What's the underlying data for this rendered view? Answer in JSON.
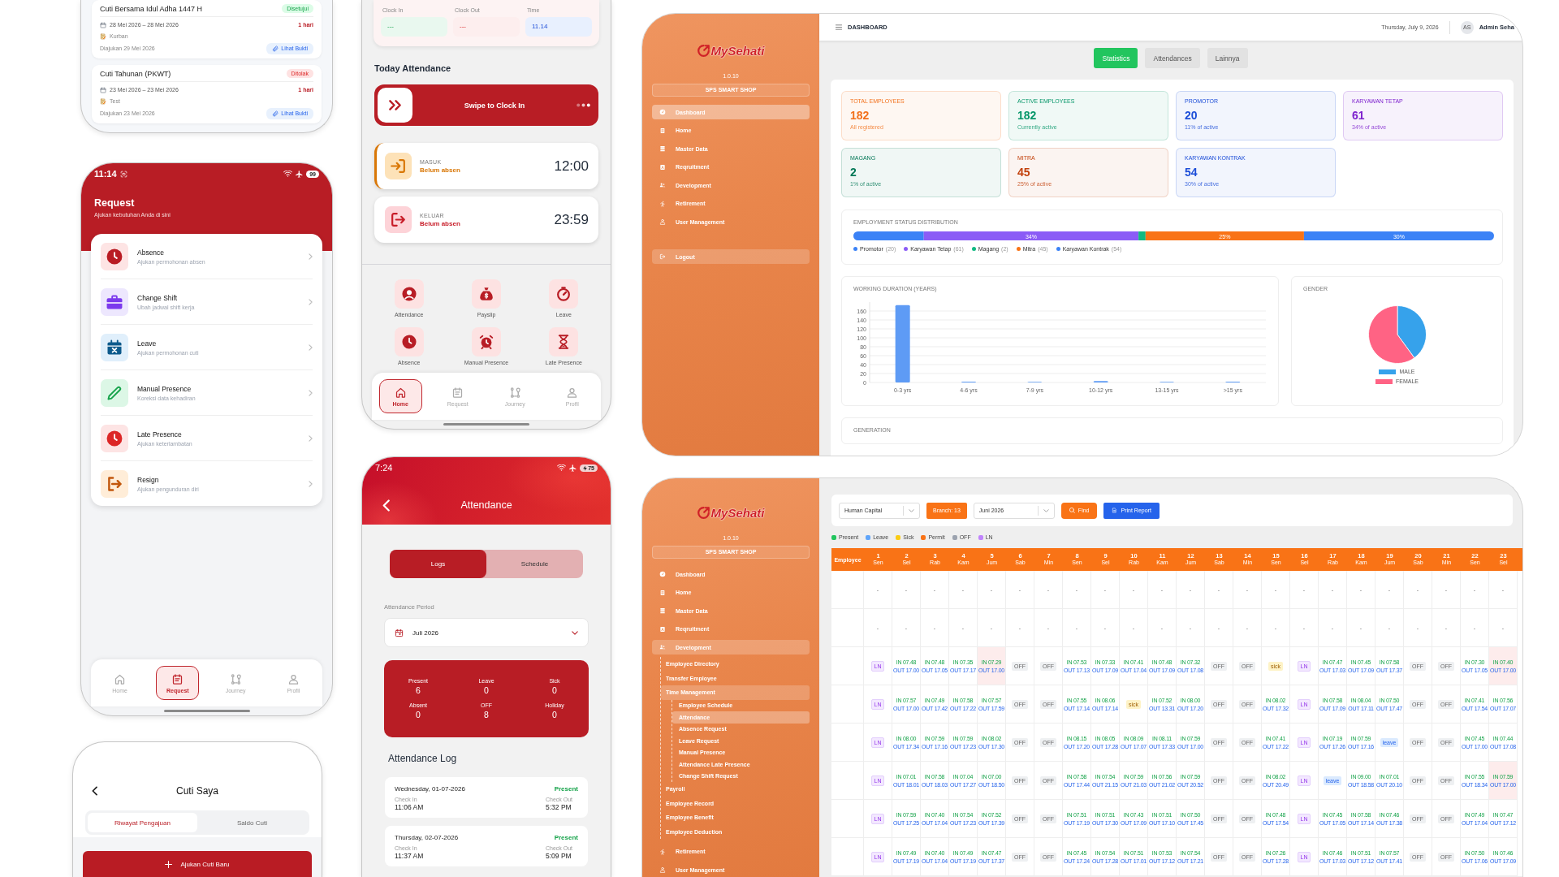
{
  "phone_leave_history": {
    "cards": [
      {
        "title": "Cuti Bersama Idul Adha 1447 H",
        "status": {
          "text": "Disetujui",
          "kind": "approved"
        },
        "dates": "28 Mei 2026 – 28 Mei 2026",
        "duration": "1 hari",
        "note": "Kurban",
        "submitted": "Diajukan 29 Mei 2026",
        "proof_button": "Lihat Bukti"
      },
      {
        "title": "Cuti Tahunan (PKWT)",
        "status": {
          "text": "Ditolak",
          "kind": "rejected"
        },
        "dates": "23 Mei 2026 – 23 Mei 2026",
        "duration": "1 hari",
        "note": "Test",
        "submitted": "Diajukan 23 Mei 2026",
        "proof_button": "Lihat Bukti"
      }
    ]
  },
  "phone_request": {
    "status_bar": {
      "time": "11:14",
      "battery": "99",
      "charging": false
    },
    "title": "Request",
    "subtitle": "Ajukan kebutuhan Anda di sini",
    "items": [
      {
        "title": "Absence",
        "subtitle": "Ajukan permohonan absen",
        "color": "#fde4e4"
      },
      {
        "title": "Change Shift",
        "subtitle": "Ubah jadwal shift kerja",
        "color": "#ede7fe"
      },
      {
        "title": "Leave",
        "subtitle": "Ajukan permohonan cuti",
        "color": "#e0effb"
      },
      {
        "title": "Manual Presence",
        "subtitle": "Koreksi data kehadiran",
        "color": "#dcf7e6"
      },
      {
        "title": "Late Presence",
        "subtitle": "Ajukan keterlambatan",
        "color": "#fde4e4"
      },
      {
        "title": "Resign",
        "subtitle": "Ajukan pengunduran diri",
        "color": "#ffedd8"
      }
    ],
    "nav": [
      {
        "label": "Home",
        "selected": false
      },
      {
        "label": "Request",
        "selected": true
      },
      {
        "label": "Journey",
        "selected": false
      },
      {
        "label": "Profil",
        "selected": false
      }
    ]
  },
  "phone_my_leave": {
    "title": "Cuti Saya",
    "tabs": [
      {
        "label": "Riwayat Pengajuan",
        "selected": true
      },
      {
        "label": "Saldo Cuti",
        "selected": false
      }
    ],
    "new_button": "Ajukan Cuti Baru"
  },
  "phone_home": {
    "summary": [
      {
        "label": "Clock In",
        "value": "---",
        "color": "#e9f8ef"
      },
      {
        "label": "Clock Out",
        "value": "---",
        "color": "#fdeeee"
      },
      {
        "label": "Time",
        "value": "11.14",
        "color": "#e8f0fe"
      }
    ],
    "section_title": "Today Attendance",
    "swipe": {
      "label": "Swipe to Clock In",
      "level": 0
    },
    "shifts": [
      {
        "label": "MASUK",
        "status": "Belum absen",
        "time": "12:00",
        "color": "#fde2b8",
        "active": true
      },
      {
        "label": "KELUAR",
        "status": "Belum absen",
        "time": "23:59",
        "color": "#fdd3d8",
        "active": false
      }
    ],
    "menu": [
      "Attendance",
      "Payslip",
      "Leave",
      "Absence",
      "Manual Presence",
      "Late Presence"
    ],
    "nav": [
      {
        "label": "Home",
        "selected": true
      },
      {
        "label": "Request",
        "selected": false
      },
      {
        "label": "Journey",
        "selected": false
      },
      {
        "label": "Profil",
        "selected": false
      }
    ]
  },
  "phone_attendance": {
    "status_bar": {
      "time": "7:24",
      "battery": "75",
      "charging": true
    },
    "title": "Attendance",
    "tabs": [
      {
        "label": "Logs",
        "selected": true
      },
      {
        "label": "Schedule",
        "selected": false
      }
    ],
    "period_label": "Attendance Period",
    "period": "Juli 2026",
    "summary": [
      {
        "label": "Present",
        "value": "6"
      },
      {
        "label": "Leave",
        "value": "0"
      },
      {
        "label": "Sick",
        "value": "0"
      },
      {
        "label": "Absent",
        "value": "0"
      },
      {
        "label": "OFF",
        "value": "8"
      },
      {
        "label": "Holiday",
        "value": "0"
      }
    ],
    "log_title": "Attendance Log",
    "logs": [
      {
        "date": "Wednesday, 01-07-2026",
        "status": "Present",
        "check_in_label": "Check In",
        "check_in": "11:06 AM",
        "check_out_label": "Check Out",
        "check_out": "5:32 PM"
      },
      {
        "date": "Thursday, 02-07-2026",
        "status": "Present",
        "check_in_label": "Check In",
        "check_in": "11:37 AM",
        "check_out_label": "Check Out",
        "check_out": "5:09 PM"
      }
    ]
  },
  "dashboard": {
    "sidebar": {
      "app_name": "MySehati",
      "version": "1.0.10",
      "company": "SPS SMART SHOP",
      "items": [
        {
          "label": "Dashboard",
          "selected": true
        },
        {
          "label": "Home",
          "selected": false
        },
        {
          "label": "Master Data",
          "selected": false
        },
        {
          "label": "Reqruitment",
          "selected": false
        },
        {
          "label": "Development",
          "selected": false
        },
        {
          "label": "Retirement",
          "selected": false
        },
        {
          "label": "User Management",
          "selected": false
        }
      ],
      "logout": "Logout"
    },
    "header": {
      "title": "DASHBOARD",
      "date": "Thursday, July 9, 2026",
      "avatar": "AS",
      "user": "Admin Seha"
    },
    "tabs": [
      {
        "label": "Statistics",
        "selected": true
      },
      {
        "label": "Attendances",
        "selected": false
      },
      {
        "label": "Lainnya",
        "selected": false
      }
    ],
    "stats": [
      {
        "title": "TOTAL EMPLOYEES",
        "value": "182",
        "caption": "All registered",
        "color": "#f2711c"
      },
      {
        "title": "ACTIVE EMPLOYEES",
        "value": "182",
        "caption": "Currently active",
        "color": "#059669"
      },
      {
        "title": "PROMOTOR",
        "value": "20",
        "caption": "11% of active",
        "color": "#1d4ed8"
      },
      {
        "title": "KARYAWAN TETAP",
        "value": "61",
        "caption": "34% of active",
        "color": "#7e22ce"
      },
      {
        "title": "MAGANG",
        "value": "2",
        "caption": "1% of active",
        "color": "#047857"
      },
      {
        "title": "MITRA",
        "value": "45",
        "caption": "25% of active",
        "color": "#c2410c"
      },
      {
        "title": "KARYAWAN KONTRAK",
        "value": "54",
        "caption": "30% of active",
        "color": "#1d4ed8"
      }
    ],
    "distribution": {
      "title": "EMPLOYMENT STATUS DISTRIBUTION",
      "groups": [
        {
          "name": "Promotor",
          "count": "(20)",
          "color": "#3b82f6"
        },
        {
          "name": "Karyawan Tetap",
          "count": "(61)",
          "color": "#8b5cf6",
          "share_label": "34%"
        },
        {
          "name": "Magang",
          "count": "(2)",
          "color": "#10b981"
        },
        {
          "name": "Mitra",
          "count": "(45)",
          "color": "#f97316",
          "share_label": "25%"
        },
        {
          "name": "Karyawan Kontrak",
          "count": "(54)",
          "color": "#3b82f6",
          "share_label": "30%"
        }
      ]
    },
    "duration_chart": {
      "chart_data": {
        "type": "bar",
        "title": "WORKING DURATION (YEARS)",
        "categories": [
          "0-3 yrs",
          "4-6 yrs",
          "7-9 yrs",
          "10-12 yrs",
          "13-15 yrs",
          ">15 yrs"
        ],
        "values": [
          173,
          2,
          1,
          3,
          1,
          2
        ],
        "ylim": [
          0,
          180
        ],
        "yticks": [
          0,
          20,
          40,
          60,
          80,
          100,
          120,
          140,
          160
        ],
        "grid": true
      }
    },
    "gender_chart": {
      "chart_data": {
        "type": "pie",
        "title": "GENDER",
        "categories": [
          "MALE",
          "FEMALE"
        ],
        "values": [
          40,
          60
        ],
        "colors": [
          "#36a2eb",
          "#ff6384"
        ],
        "legend": "bottom"
      }
    },
    "generation": {
      "title": "GENERATION"
    }
  },
  "attendance_report": {
    "sidebar": {
      "app_name": "MySehati",
      "version": "1.0.10",
      "company": "SPS SMART SHOP",
      "items": [
        {
          "label": "Dashboard",
          "selected": false
        },
        {
          "label": "Home",
          "selected": false
        },
        {
          "label": "Master Data",
          "selected": false
        },
        {
          "label": "Reqruitment",
          "selected": false
        },
        {
          "label": "Development",
          "selected": false,
          "expanded": true,
          "children": [
            {
              "label": "Employee Directory",
              "selected": false
            },
            {
              "label": "Transfer Employee",
              "selected": false
            },
            {
              "label": "Time Management",
              "selected": false,
              "expanded": true,
              "children": [
                {
                  "label": "Employee Schedule",
                  "selected": false
                },
                {
                  "label": "Attendance",
                  "selected": true
                },
                {
                  "label": "Absence Request",
                  "selected": false
                },
                {
                  "label": "Leave Request",
                  "selected": false
                },
                {
                  "label": "Manual Presence",
                  "selected": false
                },
                {
                  "label": "Attendance Late Presence",
                  "selected": false
                },
                {
                  "label": "Change Shift Request",
                  "selected": false
                }
              ]
            },
            {
              "label": "Payroll",
              "selected": false
            },
            {
              "label": "Employee Record",
              "selected": false
            },
            {
              "label": "Employee Benefit",
              "selected": false
            },
            {
              "label": "Employee Deduction",
              "selected": false
            }
          ]
        },
        {
          "label": "Retirement",
          "selected": false
        },
        {
          "label": "User Management",
          "selected": false
        }
      ]
    },
    "filters": {
      "department": "Human Capital",
      "branch": "Branch: 13",
      "period": "Juni 2026",
      "find": "Find",
      "print": "Print Report"
    },
    "legend": [
      {
        "label": "Present",
        "color": "#22c55e"
      },
      {
        "label": "Leave",
        "color": "#60a5fa"
      },
      {
        "label": "Sick",
        "color": "#facc15"
      },
      {
        "label": "Permit",
        "color": "#f97316"
      },
      {
        "label": "OFF",
        "color": "#9ca3af"
      },
      {
        "label": "LN",
        "color": "#c084fc"
      }
    ],
    "table": {
      "employee_header": "Employee",
      "days": [
        {
          "date": "1",
          "day": "Sen"
        },
        {
          "date": "2",
          "day": "Sel"
        },
        {
          "date": "3",
          "day": "Rab"
        },
        {
          "date": "4",
          "day": "Kam"
        },
        {
          "date": "5",
          "day": "Jum"
        },
        {
          "date": "6",
          "day": "Sab"
        },
        {
          "date": "7",
          "day": "Min"
        },
        {
          "date": "8",
          "day": "Sen"
        },
        {
          "date": "9",
          "day": "Sel"
        },
        {
          "date": "10",
          "day": "Rab"
        },
        {
          "date": "11",
          "day": "Kam"
        },
        {
          "date": "12",
          "day": "Jum"
        },
        {
          "date": "13",
          "day": "Sab"
        },
        {
          "date": "14",
          "day": "Min"
        },
        {
          "date": "15",
          "day": "Sen"
        },
        {
          "date": "16",
          "day": "Sel"
        },
        {
          "date": "17",
          "day": "Rab"
        },
        {
          "date": "18",
          "day": "Kam"
        },
        {
          "date": "19",
          "day": "Jum"
        },
        {
          "date": "20",
          "day": "Sab"
        },
        {
          "date": "21",
          "day": "Min"
        },
        {
          "date": "22",
          "day": "Sen"
        },
        {
          "date": "23",
          "day": "Sel"
        }
      ],
      "rows": [
        [
          {
            "kind": "empty",
            "text": "-"
          },
          {
            "kind": "empty",
            "text": "-"
          },
          {
            "kind": "empty",
            "text": "-"
          },
          {
            "kind": "empty",
            "text": "-"
          },
          {
            "kind": "empty",
            "text": "-"
          },
          {
            "kind": "empty",
            "text": "-"
          },
          {
            "kind": "empty",
            "text": "-"
          },
          {
            "kind": "empty",
            "text": "-"
          },
          {
            "kind": "empty",
            "text": "-"
          },
          {
            "kind": "empty",
            "text": "-"
          },
          {
            "kind": "empty",
            "text": "-"
          },
          {
            "kind": "empty",
            "text": "-"
          },
          {
            "kind": "empty",
            "text": "-"
          },
          {
            "kind": "empty",
            "text": "-"
          },
          {
            "kind": "empty",
            "text": "-"
          },
          {
            "kind": "empty",
            "text": "-"
          },
          {
            "kind": "empty",
            "text": "-"
          },
          {
            "kind": "empty",
            "text": "-"
          },
          {
            "kind": "empty",
            "text": "-"
          },
          {
            "kind": "empty",
            "text": "-"
          },
          {
            "kind": "empty",
            "text": "-"
          },
          {
            "kind": "empty",
            "text": "-"
          },
          {
            "kind": "empty",
            "text": "-"
          }
        ],
        [
          {
            "kind": "empty",
            "text": "-"
          },
          {
            "kind": "empty",
            "text": "-"
          },
          {
            "kind": "empty",
            "text": "-"
          },
          {
            "kind": "empty",
            "text": "-"
          },
          {
            "kind": "empty",
            "text": "-"
          },
          {
            "kind": "empty",
            "text": "-"
          },
          {
            "kind": "empty",
            "text": "-"
          },
          {
            "kind": "empty",
            "text": "-"
          },
          {
            "kind": "empty",
            "text": "-"
          },
          {
            "kind": "empty",
            "text": "-"
          },
          {
            "kind": "empty",
            "text": "-"
          },
          {
            "kind": "empty",
            "text": "-"
          },
          {
            "kind": "empty",
            "text": "-"
          },
          {
            "kind": "empty",
            "text": "-"
          },
          {
            "kind": "empty",
            "text": "-"
          },
          {
            "kind": "empty",
            "text": "-"
          },
          {
            "kind": "empty",
            "text": "-"
          },
          {
            "kind": "empty",
            "text": "-"
          },
          {
            "kind": "empty",
            "text": "-"
          },
          {
            "kind": "empty",
            "text": "-"
          },
          {
            "kind": "empty",
            "text": "-"
          },
          {
            "kind": "empty",
            "text": "-"
          },
          {
            "kind": "empty",
            "text": "-"
          }
        ],
        [
          {
            "kind": "ln",
            "text": "LN"
          },
          {
            "kind": "time",
            "in": "IN 07.48",
            "out": "OUT 17.00"
          },
          {
            "kind": "time",
            "in": "IN 07.48",
            "out": "OUT 17.05"
          },
          {
            "kind": "time",
            "in": "IN 07.35",
            "out": "OUT 17.17"
          },
          {
            "kind": "flagged",
            "in": "IN 07.29",
            "out": "OUT 17.00"
          },
          {
            "kind": "off",
            "text": "OFF"
          },
          {
            "kind": "off",
            "text": "OFF"
          },
          {
            "kind": "time",
            "in": "IN 07.53",
            "out": "OUT 17.13"
          },
          {
            "kind": "time",
            "in": "IN 07.33",
            "out": "OUT 17.09"
          },
          {
            "kind": "time",
            "in": "IN 07.41",
            "out": "OUT 17.04"
          },
          {
            "kind": "time",
            "in": "IN 07.48",
            "out": "OUT 17.09"
          },
          {
            "kind": "time",
            "in": "IN 07.32",
            "out": "OUT 17.08"
          },
          {
            "kind": "off",
            "text": "OFF"
          },
          {
            "kind": "off",
            "text": "OFF"
          },
          {
            "kind": "sick",
            "text": "sick"
          },
          {
            "kind": "ln",
            "text": "LN"
          },
          {
            "kind": "time",
            "in": "IN 07.47",
            "out": "OUT 17.03"
          },
          {
            "kind": "time",
            "in": "IN 07.45",
            "out": "OUT 17.09"
          },
          {
            "kind": "time",
            "in": "IN 07.58",
            "out": "OUT 17.37"
          },
          {
            "kind": "off",
            "text": "OFF"
          },
          {
            "kind": "off",
            "text": "OFF"
          },
          {
            "kind": "time",
            "in": "IN 07.30",
            "out": "OUT 17.05"
          },
          {
            "kind": "flagged",
            "in": "IN 07.40",
            "out": "OUT 17.00"
          }
        ],
        [
          {
            "kind": "ln",
            "text": "LN"
          },
          {
            "kind": "time",
            "in": "IN 07.57",
            "out": "OUT 17.00"
          },
          {
            "kind": "time",
            "in": "IN 07.49",
            "out": "OUT 17.42"
          },
          {
            "kind": "time",
            "in": "IN 07.58",
            "out": "OUT 17.22"
          },
          {
            "kind": "time",
            "in": "IN 07.57",
            "out": "OUT 17.59"
          },
          {
            "kind": "off",
            "text": "OFF"
          },
          {
            "kind": "off",
            "text": "OFF"
          },
          {
            "kind": "time",
            "in": "IN 07.55",
            "out": "OUT 17.14"
          },
          {
            "kind": "time",
            "in": "IN 08.06",
            "out": "OUT 17.14"
          },
          {
            "kind": "sick",
            "text": "sick"
          },
          {
            "kind": "time",
            "in": "IN 07.52",
            "out": "OUT 13.31"
          },
          {
            "kind": "time",
            "in": "IN 08.00",
            "out": "OUT 17.20"
          },
          {
            "kind": "off",
            "text": "OFF"
          },
          {
            "kind": "off",
            "text": "OFF"
          },
          {
            "kind": "time",
            "in": "IN 08.02",
            "out": "OUT 17.32"
          },
          {
            "kind": "ln",
            "text": "LN"
          },
          {
            "kind": "time",
            "in": "IN 07.58",
            "out": "OUT 17.09"
          },
          {
            "kind": "time",
            "in": "IN 08.04",
            "out": "OUT 17.11"
          },
          {
            "kind": "time",
            "in": "IN 07.50",
            "out": "OUT 17.47"
          },
          {
            "kind": "off",
            "text": "OFF"
          },
          {
            "kind": "off",
            "text": "OFF"
          },
          {
            "kind": "time",
            "in": "IN 07.41",
            "out": "OUT 17.54"
          },
          {
            "kind": "time",
            "in": "IN 07.56",
            "out": "OUT 17.07"
          }
        ],
        [
          {
            "kind": "ln",
            "text": "LN"
          },
          {
            "kind": "time",
            "in": "IN 08.00",
            "out": "OUT 17.34"
          },
          {
            "kind": "time",
            "in": "IN 07.59",
            "out": "OUT 17.16"
          },
          {
            "kind": "time",
            "in": "IN 07.59",
            "out": "OUT 17.23"
          },
          {
            "kind": "time",
            "in": "IN 08.02",
            "out": "OUT 17.30"
          },
          {
            "kind": "off",
            "text": "OFF"
          },
          {
            "kind": "off",
            "text": "OFF"
          },
          {
            "kind": "time",
            "in": "IN 08.15",
            "out": "OUT 17.20"
          },
          {
            "kind": "time",
            "in": "IN 08.05",
            "out": "OUT 17.28"
          },
          {
            "kind": "time",
            "in": "IN 08.09",
            "out": "OUT 17.07"
          },
          {
            "kind": "time",
            "in": "IN 08.11",
            "out": "OUT 17.33"
          },
          {
            "kind": "time",
            "in": "IN 07.59",
            "out": "OUT 17.00"
          },
          {
            "kind": "off",
            "text": "OFF"
          },
          {
            "kind": "off",
            "text": "OFF"
          },
          {
            "kind": "time",
            "in": "IN 07.41",
            "out": "OUT 17.22"
          },
          {
            "kind": "ln",
            "text": "LN"
          },
          {
            "kind": "time",
            "in": "IN 07.19",
            "out": "OUT 17.26"
          },
          {
            "kind": "time",
            "in": "IN 07.59",
            "out": "OUT 17.16"
          },
          {
            "kind": "leave",
            "text": "leave"
          },
          {
            "kind": "off",
            "text": "OFF"
          },
          {
            "kind": "off",
            "text": "OFF"
          },
          {
            "kind": "time",
            "in": "IN 07.45",
            "out": "OUT 17.00"
          },
          {
            "kind": "time",
            "in": "IN 07.44",
            "out": "OUT 17.08"
          }
        ],
        [
          {
            "kind": "ln",
            "text": "LN"
          },
          {
            "kind": "time",
            "in": "IN 07.01",
            "out": "OUT 18.01"
          },
          {
            "kind": "time",
            "in": "IN 07.58",
            "out": "OUT 18.03"
          },
          {
            "kind": "time",
            "in": "IN 07.04",
            "out": "OUT 17.27"
          },
          {
            "kind": "time",
            "in": "IN 07.00",
            "out": "OUT 18.50"
          },
          {
            "kind": "off",
            "text": "OFF"
          },
          {
            "kind": "off",
            "text": "OFF"
          },
          {
            "kind": "time",
            "in": "IN 07.58",
            "out": "OUT 17.44"
          },
          {
            "kind": "time",
            "in": "IN 07.54",
            "out": "OUT 21.15"
          },
          {
            "kind": "time",
            "in": "IN 07.59",
            "out": "OUT 21.03"
          },
          {
            "kind": "time",
            "in": "IN 07.56",
            "out": "OUT 21.02"
          },
          {
            "kind": "time",
            "in": "IN 07.59",
            "out": "OUT 20.52"
          },
          {
            "kind": "off",
            "text": "OFF"
          },
          {
            "kind": "off",
            "text": "OFF"
          },
          {
            "kind": "time",
            "in": "IN 08.02",
            "out": "OUT 20.49"
          },
          {
            "kind": "ln",
            "text": "LN"
          },
          {
            "kind": "leave",
            "text": "leave"
          },
          {
            "kind": "time",
            "in": "IN 09.00",
            "out": "OUT 18.58"
          },
          {
            "kind": "time",
            "in": "IN 07.01",
            "out": "OUT 20.10"
          },
          {
            "kind": "off",
            "text": "OFF"
          },
          {
            "kind": "off",
            "text": "OFF"
          },
          {
            "kind": "time",
            "in": "IN 07.55",
            "out": "OUT 18.34"
          },
          {
            "kind": "flagged",
            "in": "IN 07.59",
            "out": "OUT 17.00"
          }
        ],
        [
          {
            "kind": "ln",
            "text": "LN"
          },
          {
            "kind": "time",
            "in": "IN 07.59",
            "out": "OUT 17.25"
          },
          {
            "kind": "time",
            "in": "IN 07.40",
            "out": "OUT 17.04"
          },
          {
            "kind": "time",
            "in": "IN 07.54",
            "out": "OUT 17.23"
          },
          {
            "kind": "time",
            "in": "IN 07.52",
            "out": "OUT 17.39"
          },
          {
            "kind": "off",
            "text": "OFF"
          },
          {
            "kind": "off",
            "text": "OFF"
          },
          {
            "kind": "time",
            "in": "IN 07.51",
            "out": "OUT 17.19"
          },
          {
            "kind": "time",
            "in": "IN 07.51",
            "out": "OUT 17.30"
          },
          {
            "kind": "time",
            "in": "IN 07.43",
            "out": "OUT 17.09"
          },
          {
            "kind": "time",
            "in": "IN 07.51",
            "out": "OUT 17.10"
          },
          {
            "kind": "time",
            "in": "IN 07.50",
            "out": "OUT 17.45"
          },
          {
            "kind": "off",
            "text": "OFF"
          },
          {
            "kind": "off",
            "text": "OFF"
          },
          {
            "kind": "time",
            "in": "IN 07.48",
            "out": "OUT 17.54"
          },
          {
            "kind": "ln",
            "text": "LN"
          },
          {
            "kind": "time",
            "in": "IN 07.45",
            "out": "OUT 17.05"
          },
          {
            "kind": "time",
            "in": "IN 07.58",
            "out": "OUT 17.14"
          },
          {
            "kind": "time",
            "in": "IN 07.46",
            "out": "OUT 17.38"
          },
          {
            "kind": "off",
            "text": "OFF"
          },
          {
            "kind": "off",
            "text": "OFF"
          },
          {
            "kind": "time",
            "in": "IN 07.49",
            "out": "OUT 17.04"
          },
          {
            "kind": "time",
            "in": "IN 07.47",
            "out": "OUT 17.12"
          }
        ],
        [
          {
            "kind": "ln",
            "text": "LN"
          },
          {
            "kind": "time",
            "in": "IN 07.49",
            "out": "OUT 17.19"
          },
          {
            "kind": "time",
            "in": "IN 07.40",
            "out": "OUT 17.04"
          },
          {
            "kind": "time",
            "in": "IN 07.49",
            "out": "OUT 17.19"
          },
          {
            "kind": "time",
            "in": "IN 07.47",
            "out": "OUT 17.37"
          },
          {
            "kind": "off",
            "text": "OFF"
          },
          {
            "kind": "off",
            "text": "OFF"
          },
          {
            "kind": "time",
            "in": "IN 07.45",
            "out": "OUT 17.24"
          },
          {
            "kind": "time",
            "in": "IN 07.54",
            "out": "OUT 17.28"
          },
          {
            "kind": "time",
            "in": "IN 07.51",
            "out": "OUT 17.01"
          },
          {
            "kind": "time",
            "in": "IN 07.53",
            "out": "OUT 17.12"
          },
          {
            "kind": "time",
            "in": "IN 07.54",
            "out": "OUT 17.21"
          },
          {
            "kind": "off",
            "text": "OFF"
          },
          {
            "kind": "off",
            "text": "OFF"
          },
          {
            "kind": "time",
            "in": "IN 07.26",
            "out": "OUT 17.28"
          },
          {
            "kind": "ln",
            "text": "LN"
          },
          {
            "kind": "time",
            "in": "IN 07.46",
            "out": "OUT 17.03"
          },
          {
            "kind": "time",
            "in": "IN 07.51",
            "out": "OUT 17.12"
          },
          {
            "kind": "time",
            "in": "IN 07.57",
            "out": "OUT 17.41"
          },
          {
            "kind": "off",
            "text": "OFF"
          },
          {
            "kind": "off",
            "text": "OFF"
          },
          {
            "kind": "time",
            "in": "IN 07.50",
            "out": "OUT 17.06"
          },
          {
            "kind": "time",
            "in": "IN 07.46",
            "out": "OUT 17.09"
          }
        ]
      ]
    }
  }
}
